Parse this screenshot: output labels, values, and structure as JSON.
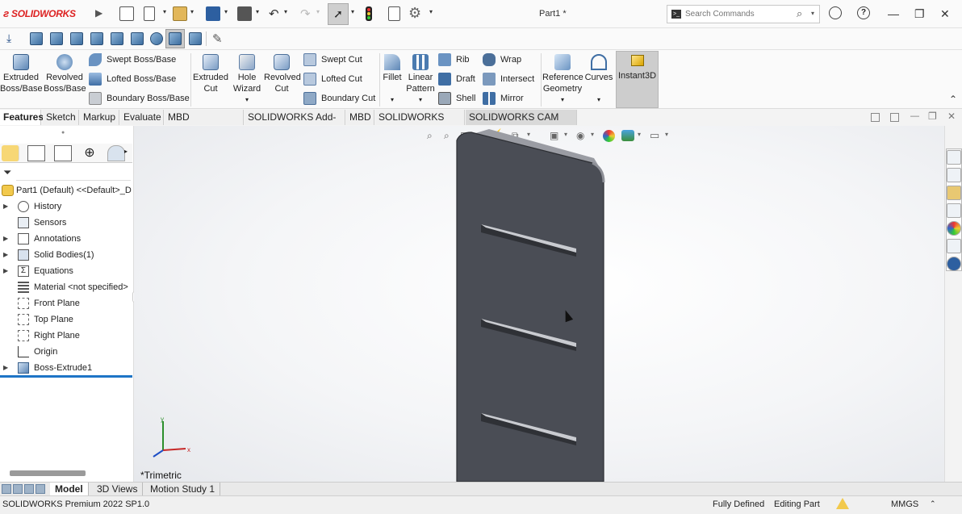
{
  "app": {
    "brand": "SOLIDWORKS",
    "document_title": "Part1 *"
  },
  "search": {
    "placeholder": "Search Commands"
  },
  "ribbon": {
    "extruded_boss": "Extruded Boss/Base",
    "revolved_boss": "Revolved Boss/Base",
    "swept_boss": "Swept Boss/Base",
    "lofted_boss": "Lofted Boss/Base",
    "boundary_boss": "Boundary Boss/Base",
    "extruded_cut": "Extruded Cut",
    "hole_wizard": "Hole Wizard",
    "revolved_cut": "Revolved Cut",
    "swept_cut": "Swept Cut",
    "lofted_cut": "Lofted Cut",
    "boundary_cut": "Boundary Cut",
    "fillet": "Fillet",
    "linear_pattern": "Linear Pattern",
    "rib": "Rib",
    "draft": "Draft",
    "shell": "Shell",
    "wrap": "Wrap",
    "intersect": "Intersect",
    "mirror": "Mirror",
    "reference_geometry": "Reference Geometry",
    "curves": "Curves",
    "instant3d": "Instant3D"
  },
  "tabs": [
    "Features",
    "Sketch",
    "Markup",
    "Evaluate",
    "MBD Dimensions",
    "SOLIDWORKS Add-Ins",
    "MBD",
    "SOLIDWORKS CAM",
    "SOLIDWORKS CAM TBM"
  ],
  "tree": {
    "root": "Part1 (Default) <<Default>_D",
    "items": [
      "History",
      "Sensors",
      "Annotations",
      "Solid Bodies(1)",
      "Equations",
      "Material <not specified>",
      "Front Plane",
      "Top Plane",
      "Right Plane",
      "Origin",
      "Boss-Extrude1"
    ]
  },
  "viewport": {
    "view_label": "*Trimetric"
  },
  "bottom_tabs": [
    "Model",
    "3D Views",
    "Motion Study 1"
  ],
  "status": {
    "product": "SOLIDWORKS Premium 2022 SP1.0",
    "state": "Fully Defined",
    "mode": "Editing Part",
    "units": "MMGS"
  },
  "colors": {
    "part_face": "#4a4d55",
    "brand_red": "#d22222",
    "accent_blue": "#1e74c6"
  }
}
